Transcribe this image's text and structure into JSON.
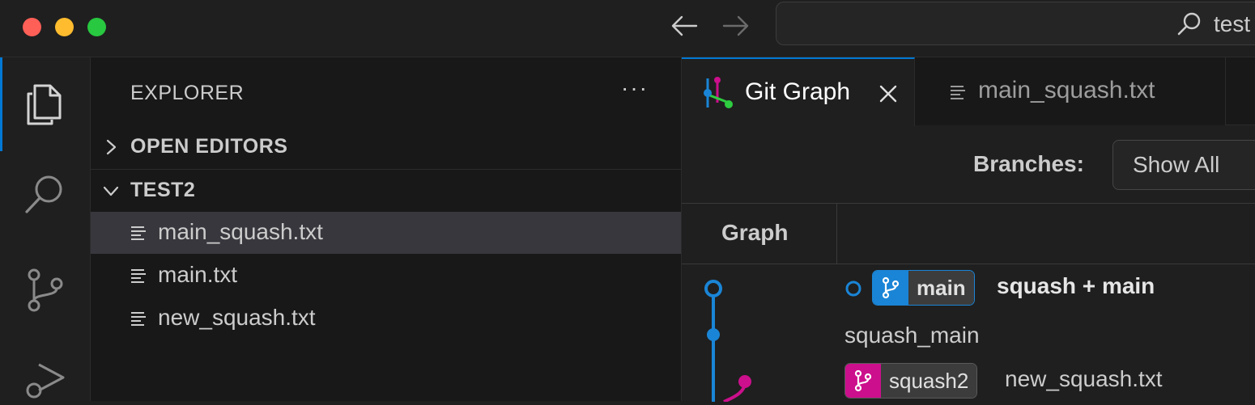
{
  "titlebar": {
    "search_text": "test",
    "icons": [
      "arrow-left-icon",
      "arrow-right-icon",
      "search-icon"
    ]
  },
  "activity_bar": {
    "icons": [
      "files-icon",
      "search-icon",
      "source-control-icon",
      "run-debug-icon"
    ]
  },
  "sidebar": {
    "title": "EXPLORER",
    "more": "···",
    "sections": [
      {
        "label": "OPEN EDITORS",
        "expanded": false
      },
      {
        "label": "TEST2",
        "expanded": true
      }
    ],
    "files": [
      {
        "label": "main_squash.txt",
        "selected": true
      },
      {
        "label": "main.txt",
        "selected": false
      },
      {
        "label": "new_squash.txt",
        "selected": false
      }
    ]
  },
  "editor": {
    "tabs": [
      {
        "label": "Git Graph",
        "active": true
      },
      {
        "label": "main_squash.txt",
        "active": false
      }
    ],
    "branches_label": "Branches:",
    "branches_value": "Show All",
    "graph_column": "Graph",
    "commits": [
      {
        "ref": "main",
        "message": "squash + main",
        "ref_color": "#1a85d6"
      },
      {
        "message": "squash_main"
      },
      {
        "ref": "squash2",
        "message": "new_squash.txt",
        "ref_color": "#cc0f8c"
      }
    ]
  },
  "colors": {
    "accent": "#0078d4",
    "graph_blue": "#1a85d6",
    "graph_pink": "#cc0f8c"
  }
}
